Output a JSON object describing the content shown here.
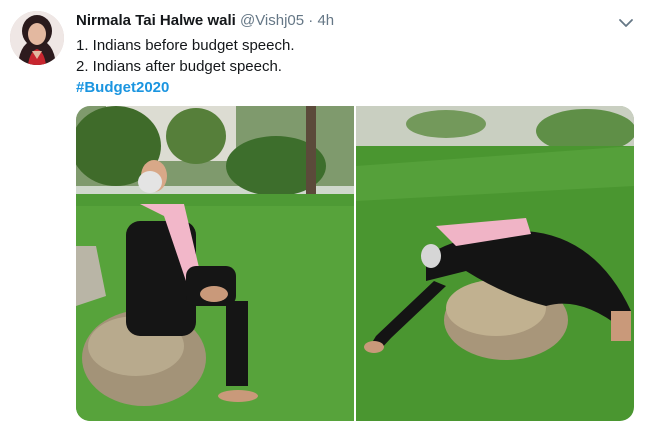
{
  "tweet": {
    "author_name": "Nirmala Tai Halwe wali",
    "handle": "@Vishj05",
    "separator": "·",
    "time": "4h",
    "lines": [
      "1. Indians before budget speech.",
      "2. Indians after budget speech."
    ],
    "hashtag": "#Budget2020"
  },
  "icons": {
    "menu": "chevron-down-icon",
    "avatar": "profile-avatar"
  },
  "colors": {
    "link": "#1b95e0",
    "name": "#14171a",
    "meta": "#657786",
    "grass": "#4e9a35"
  },
  "media": {
    "count": 2,
    "photos": [
      {
        "description": "man seated on rock in garden"
      },
      {
        "description": "man lying face down over rock in garden"
      }
    ]
  }
}
